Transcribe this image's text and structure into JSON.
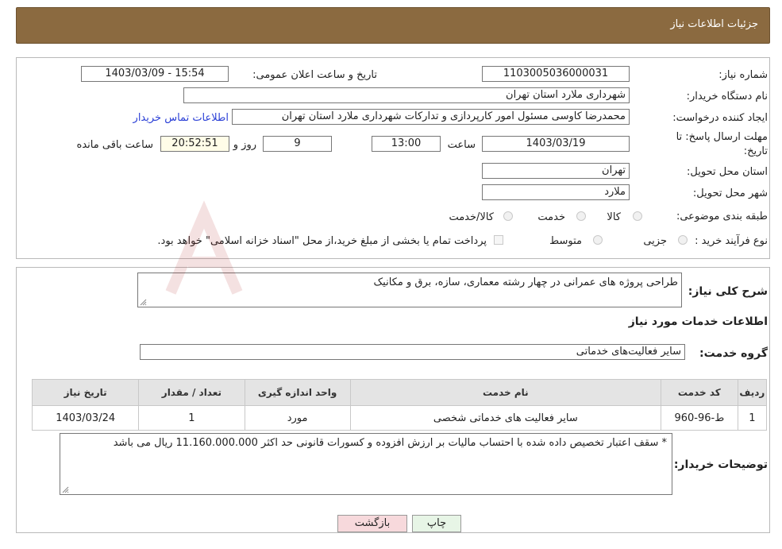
{
  "header": {
    "title": "جزئیات اطلاعات نیاز"
  },
  "form": {
    "need_number_label": "شماره نیاز:",
    "need_number": "1103005036000031",
    "announce_label": "تاریخ و ساعت اعلان عمومی:",
    "announce_value": "1403/03/09 - 15:54",
    "buyer_org_label": "نام دستگاه خریدار:",
    "buyer_org": "شهرداری ملارد استان تهران",
    "creator_label": "ایجاد کننده درخواست:",
    "creator": "محمدرضا کاوسی مسئول امور کارپردازی و تدارکات  شهرداری ملارد استان تهران",
    "contact_link": "اطلاعات تماس خریدار",
    "deadline_label_line1": "مهلت ارسال پاسخ: تا",
    "deadline_label_line2": "تاریخ:",
    "deadline_date": "1403/03/19",
    "time_label": "ساعت",
    "deadline_time": "13:00",
    "days_value": "9",
    "days_label": "روز و",
    "remaining_time": "20:52:51",
    "remaining_label": "ساعت باقی مانده",
    "province_label": "استان محل تحویل:",
    "province": "تهران",
    "city_label": "شهر محل تحویل:",
    "city": "ملارد",
    "category_label": "طبقه بندی موضوعی:",
    "category_options": [
      "کالا",
      "خدمت",
      "کالا/خدمت"
    ],
    "category_selected": "خدمت",
    "process_label": "نوع فرآیند خرید :",
    "process_options": [
      "جزیی",
      "متوسط"
    ],
    "payment_note": "پرداخت تمام یا بخشی از مبلغ خرید،از محل \"اسناد خزانه اسلامی\" خواهد بود."
  },
  "details": {
    "summary_label": "شرح کلی نیاز:",
    "summary": "طراحی پروژه های عمرانی در چهار رشته معماری، سازه، برق و مکانیک",
    "services_heading": "اطلاعات خدمات مورد نیاز",
    "service_group_label": "گروه خدمت:",
    "service_group": "سایر فعالیت‌های خدماتی",
    "table": {
      "headers": [
        "ردیف",
        "کد خدمت",
        "نام خدمت",
        "واحد اندازه گیری",
        "تعداد / مقدار",
        "تاریخ نیاز"
      ],
      "rows": [
        [
          "1",
          "ط-96-960",
          "سایر فعالیت های خدماتی شخصی",
          "مورد",
          "1",
          "1403/03/24"
        ]
      ]
    },
    "buyer_notes_label": "توضیحات خریدار:",
    "buyer_notes": "* سقف اعتبار تخصیص داده شده با احتساب مالیات بر ارزش افزوده و کسورات قانونی حد اکثر 11.160.000.000  ریال می باشد"
  },
  "buttons": {
    "print": "چاپ",
    "back": "بازگشت"
  },
  "colors": {
    "header_bg": "#8b6a40",
    "link": "#2a3fd6",
    "table_header_bg": "#e4e4e4",
    "back_button_bg": "#f7d9dc",
    "print_button_bg": "#e7f5e6"
  }
}
